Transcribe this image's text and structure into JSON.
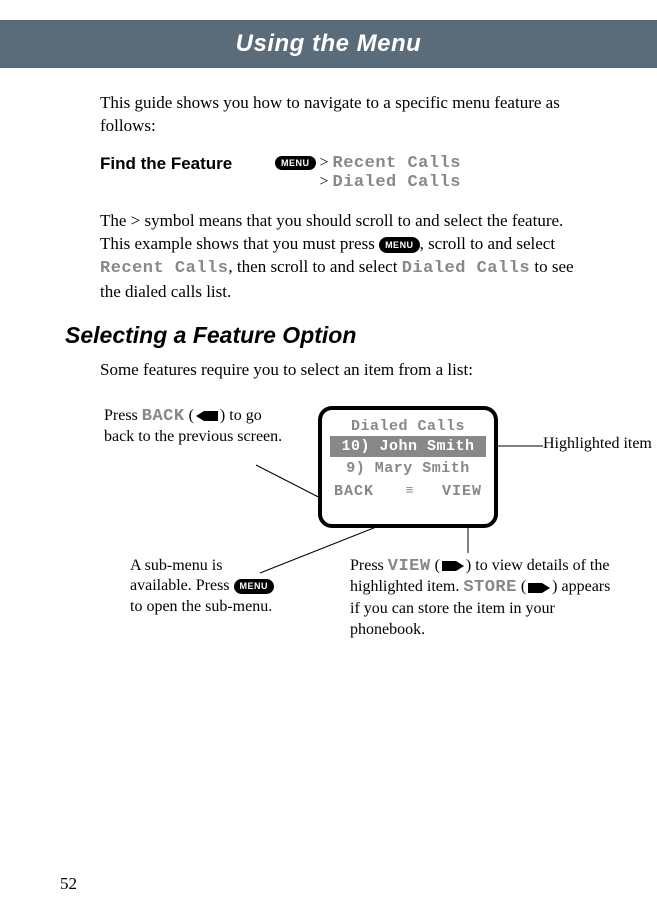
{
  "header": {
    "title": "Using the Menu"
  },
  "intro": "This guide shows you how to navigate to a specific menu feature as follows:",
  "find_feature": {
    "label": "Find the Feature",
    "menu_key": "MENU",
    "gt1": ">",
    "path1": "Recent Calls",
    "gt2": ">",
    "path2": "Dialed Calls"
  },
  "explain": {
    "pre": "The > symbol means that you should scroll to and select the feature. This example shows that you must press ",
    "menu_key": "MENU",
    "mid1": ", scroll to and select ",
    "rc": "Recent Calls",
    "mid2": ", then scroll to and select ",
    "dc": "Dialed Calls",
    "post": " to see the dialed calls list."
  },
  "h2": "Selecting a Feature Option",
  "h2_intro": "Some features require you to select an item from a list:",
  "screen": {
    "title": "Dialed Calls",
    "item_hl": "10) John Smith",
    "item2": "9) Mary Smith",
    "soft_left": "BACK",
    "soft_right": "VIEW"
  },
  "callouts": {
    "back": {
      "pre": "Press ",
      "key": "BACK",
      "post": " to go back to the previous screen.",
      "paren_open": " (",
      "paren_close": ")"
    },
    "hl": "Highlighted item",
    "submenu": {
      "l1": "A sub-menu is available. Press ",
      "menu_key": "MENU",
      "l2": " to open the sub-menu."
    },
    "view": {
      "pre": "Press ",
      "key": "VIEW",
      "post1": " to view details of the highlighted item. ",
      "store": "STORE",
      "post2": " appears if you can store the item in your phonebook.",
      "paren_open": " (",
      "paren_close": ")"
    }
  },
  "page_number": "52"
}
